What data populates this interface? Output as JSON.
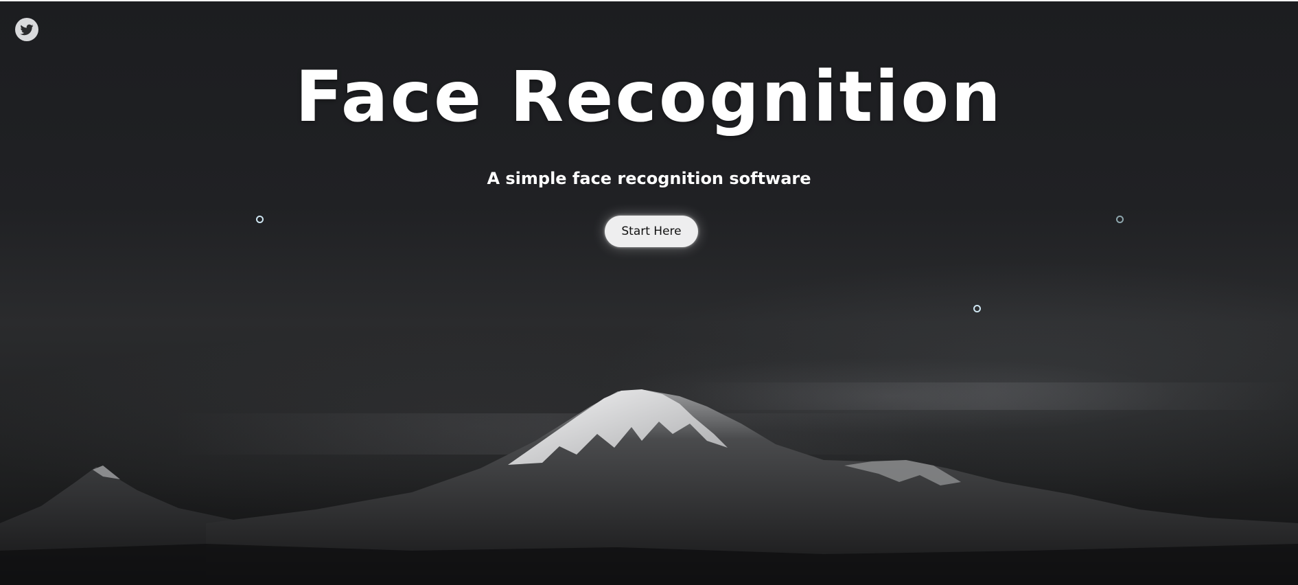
{
  "header": {
    "social_icon": "twitter-icon"
  },
  "hero": {
    "title": "Face Recognition",
    "subtitle": "A simple face recognition software",
    "cta_label": "Start Here"
  },
  "decorations": {
    "particle_icon": "ring-particle"
  },
  "colors": {
    "background": "#1f2022",
    "title_text": "#ffffff",
    "button_background": "#eeeeef",
    "button_text": "#111111",
    "icon_background": "#d9dadc"
  }
}
